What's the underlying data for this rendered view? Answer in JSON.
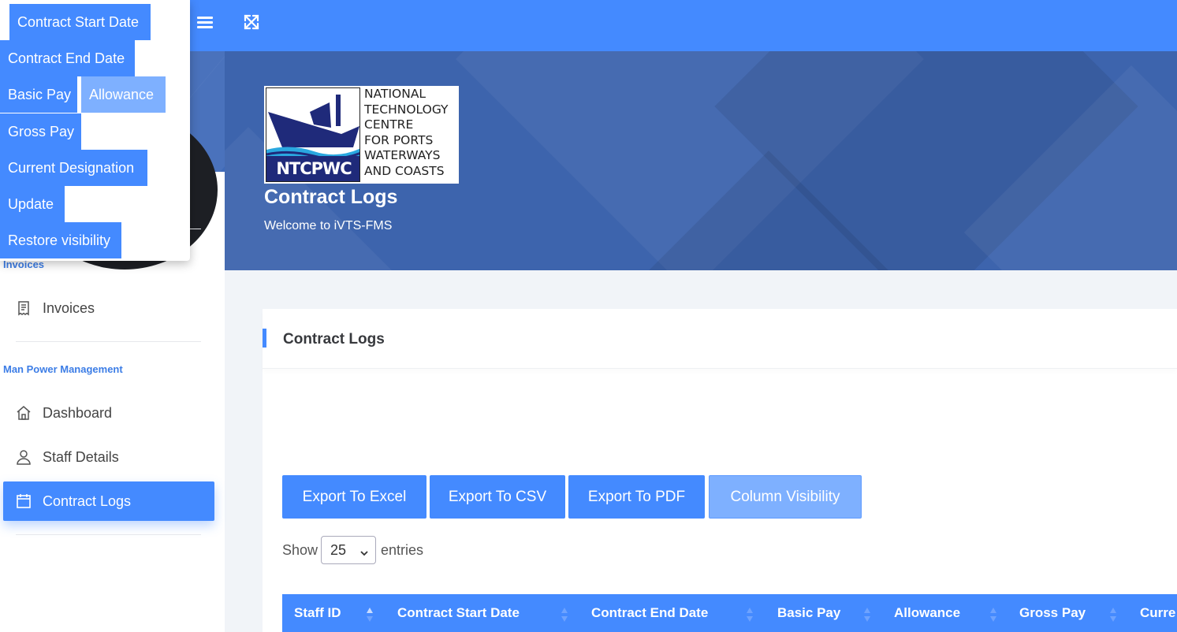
{
  "colors": {
    "primary": "#448aff",
    "primary_light": "#7eb0ff",
    "banner": "#3d64ad"
  },
  "topbar": {
    "menu_icon": "hamburger-icon",
    "fullscreen_icon": "expand-icon"
  },
  "sidebar": {
    "section_invoices": "Invoices",
    "invoices_item": {
      "label": "Invoices",
      "icon": "receipt-icon"
    },
    "section_manpower": "Man Power Management",
    "items": [
      {
        "label": "Dashboard",
        "icon": "home-icon",
        "active": false
      },
      {
        "label": "Staff Details",
        "icon": "user-icon",
        "active": false
      },
      {
        "label": "Contract Logs",
        "icon": "calendar-icon",
        "active": true
      }
    ]
  },
  "banner": {
    "logo": {
      "abbr": "NTCPWC",
      "lines": "NATIONAL\nTECHNOLOGY\nCENTRE\nFOR PORTS\nWATERWAYS\nAND COASTS"
    },
    "title": "Contract Logs",
    "subtitle": "Welcome to iVTS-FMS"
  },
  "card": {
    "title": "Contract Logs",
    "buttons": [
      "Export To Excel",
      "Export To CSV",
      "Export To PDF",
      "Column Visibility"
    ],
    "show_label": "Show",
    "entries_value": "25",
    "entries_label": "entries",
    "columns": [
      "Staff ID",
      "Contract Start Date",
      "Contract End Date",
      "Basic Pay",
      "Allowance",
      "Gross Pay",
      "Curre"
    ]
  },
  "column_visibility_menu": {
    "items": [
      {
        "label": "Contract Start Date",
        "visible": true
      },
      {
        "label": "Contract End Date",
        "visible": true
      },
      {
        "label": "Basic Pay",
        "visible": true
      },
      {
        "label": "Allowance",
        "visible": false
      },
      {
        "label": "Gross Pay",
        "visible": true
      },
      {
        "label": "Current Designation",
        "visible": true
      },
      {
        "label": "Update",
        "visible": true
      },
      {
        "label": "Restore visibility",
        "visible": true
      }
    ]
  }
}
